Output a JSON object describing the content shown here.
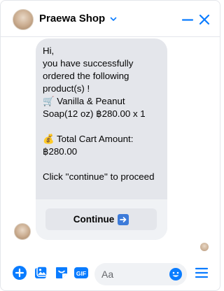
{
  "header": {
    "title": "Praewa Shop"
  },
  "message": {
    "text": "Hi,\nyou have successfully ordered the following product(s)  !\n🛒 Vanilla & Peanut Soap(12 oz) ฿280.00 x 1\n\n💰 Total Cart Amount: ฿280.00\n\nClick ''continue'' to proceed",
    "button_label": "Continue"
  },
  "composer": {
    "placeholder": "Aa"
  },
  "colors": {
    "accent": "#0a7cff",
    "bubble": "#e4e6eb"
  }
}
